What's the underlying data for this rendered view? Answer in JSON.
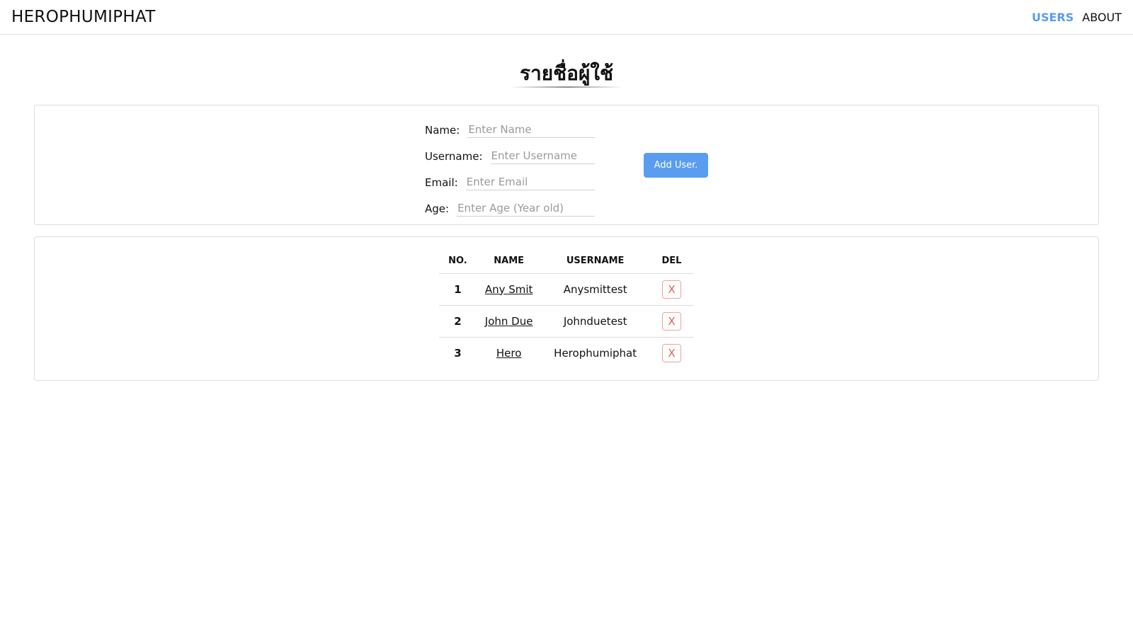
{
  "navbar": {
    "brand": "HEROPHUMIPHAT",
    "links": [
      {
        "label": "USERS",
        "active": true
      },
      {
        "label": "ABOUT",
        "active": false
      }
    ]
  },
  "page": {
    "title": "รายชื่อผู้ใช้"
  },
  "form": {
    "fields": [
      {
        "label": "Name:",
        "placeholder": "Enter Name",
        "value": ""
      },
      {
        "label": "Username:",
        "placeholder": "Enter Username",
        "value": ""
      },
      {
        "label": "Email:",
        "placeholder": "Enter Email",
        "value": ""
      },
      {
        "label": "Age:",
        "placeholder": "Enter Age (Year old)",
        "value": ""
      }
    ],
    "submit_label": "Add User."
  },
  "table": {
    "headers": [
      "NO.",
      "NAME",
      "USERNAME",
      "DEL"
    ],
    "rows": [
      {
        "no": "1",
        "name": "Any Smit",
        "username": "Anysmittest",
        "del": "X"
      },
      {
        "no": "2",
        "name": "John Due",
        "username": "Johnduetest",
        "del": "X"
      },
      {
        "no": "3",
        "name": "Hero",
        "username": "Herophumiphat",
        "del": "X"
      }
    ]
  },
  "colors": {
    "accent": "#5a9cf0",
    "danger": "#ee5b5b",
    "border": "#dcdcdc"
  }
}
